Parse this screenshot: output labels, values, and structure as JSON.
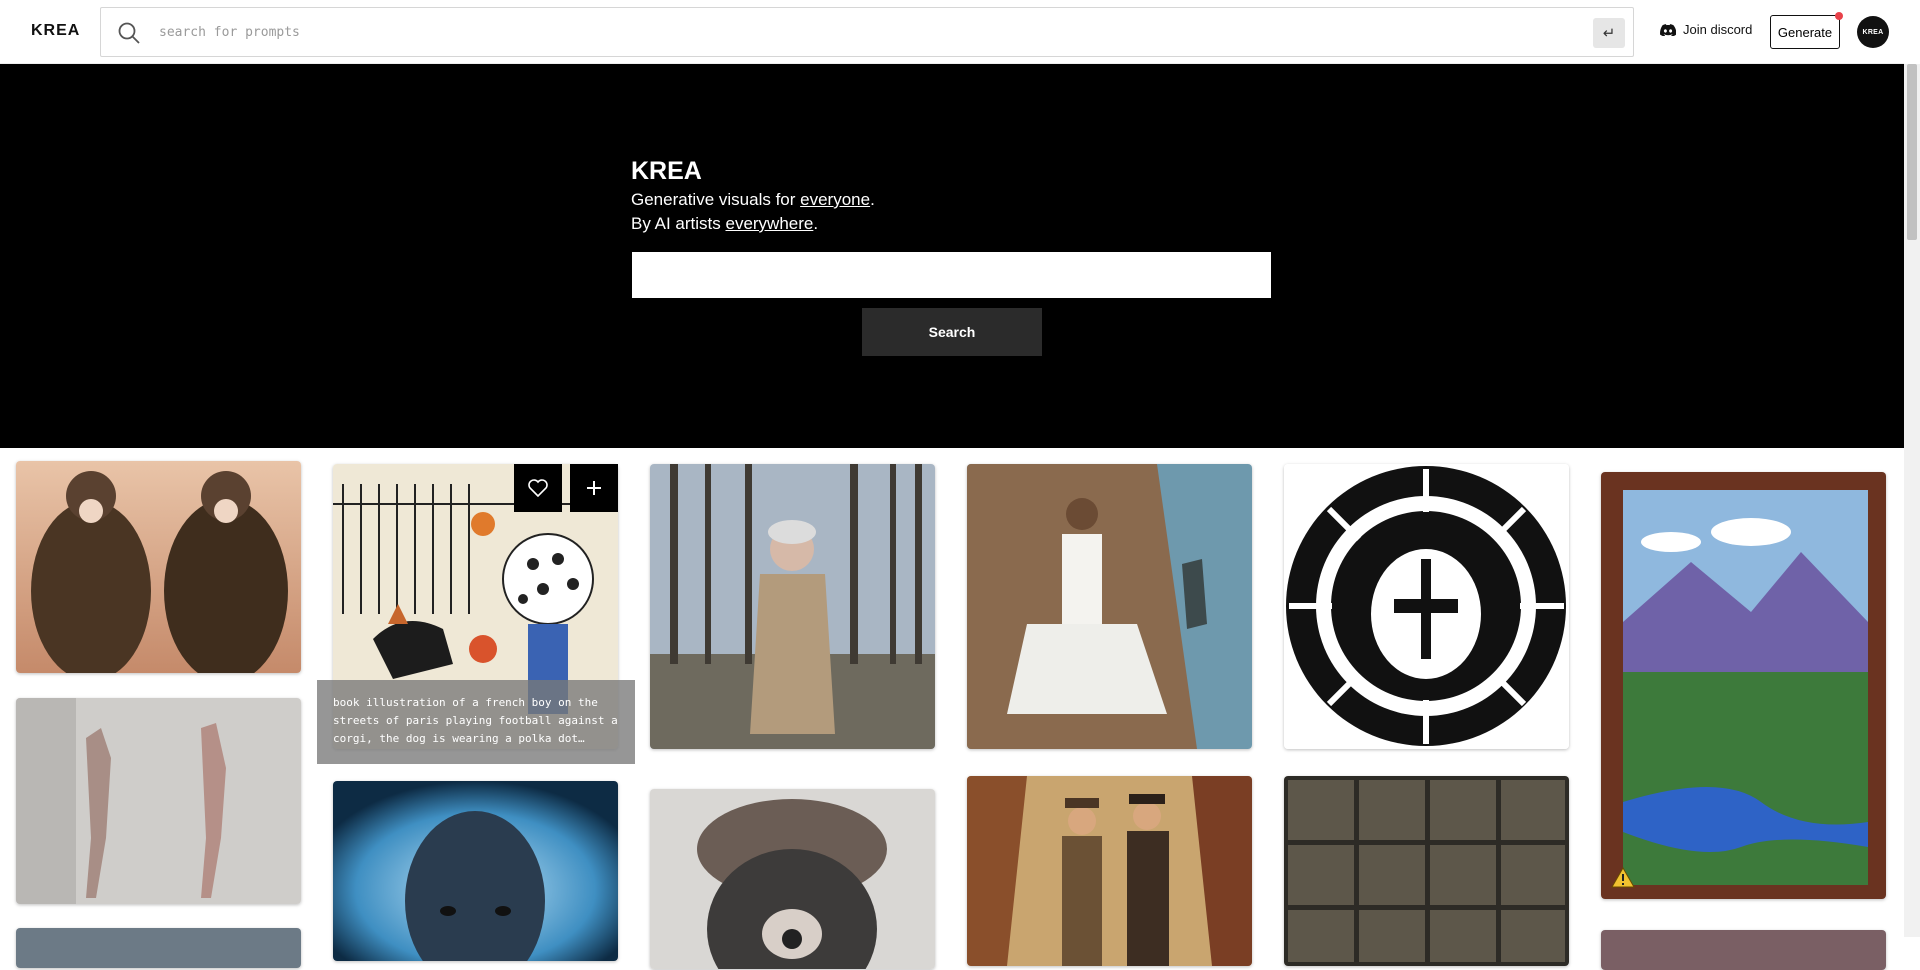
{
  "header": {
    "logo": "KREA",
    "search_placeholder": "search for prompts",
    "enter_key": "↵",
    "discord_label": "Join discord",
    "generate_label": "Generate",
    "avatar_text": "KREA"
  },
  "hero": {
    "title": "KREA",
    "line1_prefix": "Generative visuals for ",
    "line1_link": "everyone",
    "line1_suffix": ".",
    "line2_prefix": "By AI artists ",
    "line2_link": "everywhere",
    "line2_suffix": ".",
    "search_value": "",
    "search_button": "Search"
  },
  "hover_caption": "book illustration of a french boy on the streets of paris playing football against a corgi, the dog is wearing a polka dot…",
  "colors": {
    "hero_bg": "#000000",
    "search_button_bg": "#2b2b2b",
    "notification_dot": "#e8414a"
  }
}
